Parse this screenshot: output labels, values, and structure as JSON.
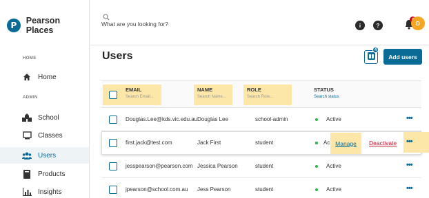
{
  "brand": {
    "name": "Pearson Places",
    "logo_letter": "P"
  },
  "sidebar": {
    "sections": [
      {
        "label": "HOME"
      },
      {
        "label": "ADMIN"
      }
    ],
    "items": [
      {
        "label": "Home",
        "icon": "home-icon"
      },
      {
        "label": "School",
        "icon": "school-icon"
      },
      {
        "label": "Classes",
        "icon": "classes-icon"
      },
      {
        "label": "Users",
        "icon": "users-icon",
        "active": true
      },
      {
        "label": "Products",
        "icon": "products-icon"
      },
      {
        "label": "Insights",
        "icon": "insights-icon"
      }
    ]
  },
  "header": {
    "search_text": "What are you looking for?",
    "info_glyph": "i",
    "help_glyph": "?",
    "notifications_count": "4",
    "avatar_initial": "D"
  },
  "main": {
    "title": "Users",
    "grid_badge": "4",
    "add_button": "Add users",
    "columns": [
      {
        "title": "EMAIL",
        "placeholder": "Search Email..."
      },
      {
        "title": "NAME",
        "placeholder": "Search Name..."
      },
      {
        "title": "ROLE",
        "placeholder": "Search Role..."
      },
      {
        "title": "STATUS",
        "sub": "Search status"
      }
    ],
    "rows": [
      {
        "email": "Douglas.Lee@kds.vic.edu.au",
        "name": "Douglas Lee",
        "role": "school-admin",
        "status": "Active"
      },
      {
        "email": "first.jack@test.com",
        "name": "Jack First",
        "role": "student",
        "status": "Ac",
        "manage": "Manage",
        "deactivate": "Deactivate"
      },
      {
        "email": "jesspearson@pearson.com",
        "name": "Jessica Pearson",
        "role": "student",
        "status": "Active"
      },
      {
        "email": "jpearson@school.com.au",
        "name": "Jess Pearson",
        "role": "student",
        "status": "Active"
      }
    ],
    "more_glyph": "•••"
  },
  "colors": {
    "accent": "#0a6b97",
    "highlight": "#fde7a8",
    "active_dot": "#2fb34a",
    "danger": "#c8102e",
    "avatar": "#f5a623"
  }
}
